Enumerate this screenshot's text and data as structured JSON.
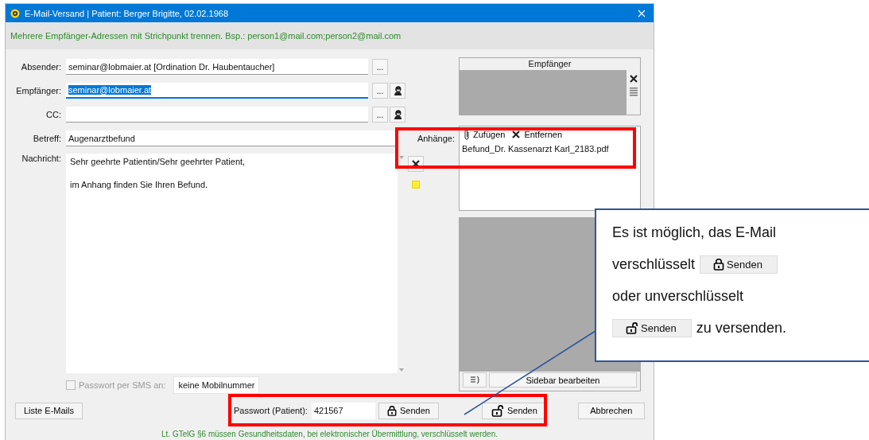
{
  "window": {
    "title": "E-Mail-Versand | Patient: Berger Brigitte, 02.02.1968"
  },
  "hint": "Mehrere Empfänger-Adressen mit Strichpunkt trennen. Bsp.: person1@mail.com;person2@mail.com",
  "fields": [
    {
      "label": "Absender:",
      "value": "seminar@lobmaier.at [Ordination Dr. Haubentaucher]",
      "text_selected": false,
      "browse": "...",
      "contacts": false
    },
    {
      "label": "Empfänger:",
      "value": "seminar@lobmaier.at",
      "text_selected": true,
      "browse": "...",
      "contacts": true
    },
    {
      "label": "CC:",
      "browse": "...",
      "contacts": true
    }
  ],
  "subject": {
    "label": "Betreff:",
    "value": "Augenarztbefund"
  },
  "message": {
    "label": "Nachricht:",
    "lines": [
      "Sehr geehrte Patientin/Sehr geehrter Patient,",
      "im Anhang finden Sie Ihren Befund."
    ]
  },
  "sms": {
    "label": "Passwort per SMS an:",
    "checked": false,
    "disabled": true,
    "value": "keine Mobilnummer"
  },
  "recipients_panel": {
    "title": "Empfänger"
  },
  "attachments": {
    "highlighted": true,
    "label": "Anhänge:",
    "add": "Zufügen",
    "remove": "Entfernen",
    "files": [
      "Befund_Dr. Kassenarzt Karl_2183.pdf"
    ]
  },
  "sidebar": {
    "button": "Sidebar bearbeiten"
  },
  "bottom": {
    "highlighted": true,
    "list_button": "Liste E-Mails",
    "password_label": "Passwort (Patient):",
    "password": "421567",
    "send_encrypted": "Senden",
    "send_plain": "Senden",
    "cancel": "Abbrechen",
    "notice": "Lt. GTelG §6 müssen Gesundheitsdaten, bei elektronischer Übermittlung, verschlüsselt werden."
  },
  "callout": {
    "lines": [
      [
        {
          "kind": "text",
          "text": "Es ist möglich, das   E-Mail"
        }
      ],
      [
        {
          "kind": "text",
          "text": "verschlüsselt"
        },
        {
          "kind": "locked_button",
          "text": "Senden"
        }
      ],
      [
        {
          "kind": "text",
          "text": "oder unverschlüsselt"
        }
      ],
      [
        {
          "kind": "unlocked_button",
          "text": "Senden"
        },
        {
          "kind": "text",
          "text": "zu versenden."
        }
      ]
    ]
  }
}
